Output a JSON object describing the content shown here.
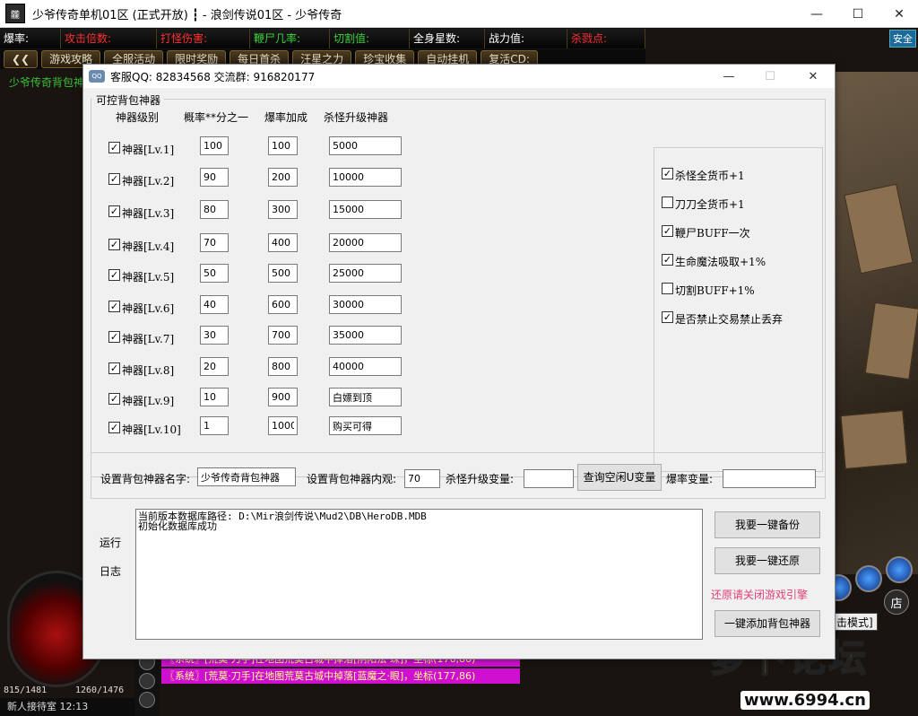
{
  "game_window": {
    "title": "少爷传奇单机01区 (正式开放) ┇ - 浪剑传说01区 - 少爷传奇",
    "icon_text": "龖",
    "controls": {
      "minimize": "—",
      "maximize": "☐",
      "close": "✕"
    },
    "safe_badge": "安全",
    "stats": [
      {
        "label": "爆率:",
        "color": "#ffffff"
      },
      {
        "label": "攻击倍数:",
        "color": "#ff3030"
      },
      {
        "label": "打怪伤害:",
        "color": "#ff3030"
      },
      {
        "label": "鞭尸几率:",
        "color": "#40d040"
      },
      {
        "label": "切割值:",
        "color": "#40d040"
      },
      {
        "label": "全身星数:",
        "color": "#ffffff"
      },
      {
        "label": "战力值:",
        "color": "#ffffff"
      },
      {
        "label": "杀戮点:",
        "color": "#ff3030"
      }
    ],
    "menu": [
      "❮❮",
      "游戏攻略",
      "全服活动",
      "限时奖励",
      "每日首杀",
      "汪星之力",
      "珍宝收集",
      "自动挂机",
      "复活CD:"
    ],
    "left_text": "少爷传奇背包神",
    "hp": "815/1481",
    "mp": "1260/1476",
    "room": "新人接待室 12:13",
    "chat": [
      "〖系统〗[荒莫·刀手]在地图荒莫古城中掉落[阴阳法·珠]，坐标(176,86)",
      "〖系统〗[荒莫·刀手]在地图荒莫古城中掉落[蓝魔之·眼]，坐标(177,86)"
    ],
    "shop_label": "店",
    "mode_label": "击模式]",
    "watermark_text": "萝卜论坛",
    "watermark_url": "www.6994.cn"
  },
  "dialog": {
    "icon_text": "QQ",
    "title": "客服QQ:  82834568    交流群:  916820177",
    "controls": {
      "minimize": "—",
      "maximize": "☐",
      "close": "✕"
    },
    "group_title": "可控背包神器",
    "headers": {
      "level": "神器级别",
      "prob": "概率**分之一",
      "bonus": "爆率加成",
      "kill": "杀怪升级神器"
    },
    "rows": [
      {
        "label": "神器[Lv.1]",
        "checked": true,
        "prob": "100",
        "bonus": "100",
        "kill": "5000"
      },
      {
        "label": "神器[Lv.2]",
        "checked": true,
        "prob": "90",
        "bonus": "200",
        "kill": "10000"
      },
      {
        "label": "神器[Lv.3]",
        "checked": true,
        "prob": "80",
        "bonus": "300",
        "kill": "15000"
      },
      {
        "label": "神器[Lv.4]",
        "checked": true,
        "prob": "70",
        "bonus": "400",
        "kill": "20000"
      },
      {
        "label": "神器[Lv.5]",
        "checked": true,
        "prob": "50",
        "bonus": "500",
        "kill": "25000"
      },
      {
        "label": "神器[Lv.6]",
        "checked": true,
        "prob": "40",
        "bonus": "600",
        "kill": "30000"
      },
      {
        "label": "神器[Lv.7]",
        "checked": true,
        "prob": "30",
        "bonus": "700",
        "kill": "35000"
      },
      {
        "label": "神器[Lv.8]",
        "checked": true,
        "prob": "20",
        "bonus": "800",
        "kill": "40000"
      },
      {
        "label": "神器[Lv.9]",
        "checked": true,
        "prob": "10",
        "bonus": "900",
        "kill": "白嫖到顶"
      },
      {
        "label": "神器[Lv.10]",
        "checked": true,
        "prob": "1",
        "bonus": "1000",
        "kill": "购买可得"
      }
    ],
    "options": [
      {
        "label": "杀怪全货币+1",
        "checked": true
      },
      {
        "label": "刀刀全货币+1",
        "checked": false
      },
      {
        "label": "鞭尸BUFF一次",
        "checked": true
      },
      {
        "label": "生命魔法吸取+1%",
        "checked": true
      },
      {
        "label": "切割BUFF+1%",
        "checked": false
      },
      {
        "label": "是否禁止交易禁止丢弃",
        "checked": true
      }
    ],
    "settings": {
      "name_label": "设置背包神器名字:",
      "name_value": "少爷传奇背包神器",
      "look_label": "设置背包神器内观:",
      "look_value": "70",
      "kill_var_label": "杀怪升级变量:",
      "kill_var_value": "",
      "query_button": "查询空闲U变量",
      "drop_var_label": "爆率变量:",
      "drop_var_value": ""
    },
    "log": {
      "label_run": "运行",
      "label_log": "日志",
      "lines": [
        "当前版本数据库路径: D:\\Mir浪剑传说\\Mud2\\DB\\HeroDB.MDB",
        "初始化数据库成功"
      ]
    },
    "buttons": {
      "backup": "我要一键备份",
      "restore": "我要一键还原",
      "add": "一键添加背包神器"
    },
    "restore_note": "还原请关闭游戏引擎"
  }
}
